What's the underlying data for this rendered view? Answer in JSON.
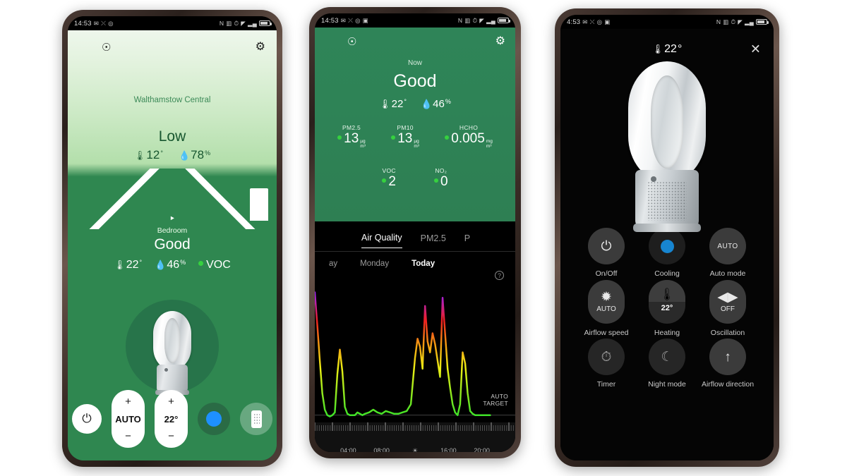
{
  "status_bar": {
    "time": "14:53",
    "time_phone3": "4:53",
    "left_icons": [
      "message-icon",
      "share-icon",
      "alarm-icon",
      "photo-icon"
    ],
    "right_icons": [
      "nfc-N",
      "vibrate-icon",
      "alarm-icon",
      "wifi-icon",
      "signal-icon",
      "battery-icon"
    ]
  },
  "phone1": {
    "topbar": {
      "menu": "menu-icon",
      "bell": "♁",
      "gear": "⚙"
    },
    "outdoor": {
      "location": "Walthamstow Central",
      "level": "Low",
      "temperature": "12",
      "temperature_unit": "°",
      "humidity": "78",
      "humidity_unit": "%"
    },
    "indoor": {
      "wifi": "wifi-icon",
      "room": "Bedroom",
      "quality": "Good",
      "temperature": "22",
      "temperature_unit": "°",
      "humidity": "46",
      "humidity_unit": "%",
      "voc_label": "VOC"
    },
    "controls": {
      "power": "⏻",
      "fan_plus": "+",
      "fan_value": "AUTO",
      "fan_minus": "−",
      "temp_plus": "+",
      "temp_value": "22°",
      "temp_minus": "−",
      "cooling": "cooling-toggle",
      "remote": "remote-icon"
    }
  },
  "phone2": {
    "header": {
      "now_label": "Now",
      "quality": "Good",
      "temperature": "22",
      "temperature_unit": "°",
      "humidity": "46",
      "humidity_unit": "%"
    },
    "pollutants": [
      {
        "label": "PM2.5",
        "value": "13",
        "unit": "µg\nm³"
      },
      {
        "label": "PM10",
        "value": "13",
        "unit": "µg\nm³"
      },
      {
        "label": "HCHO",
        "value": "0.005",
        "unit": "mg\nm³"
      },
      {
        "label": "VOC",
        "value": "2",
        "unit": ""
      },
      {
        "label": "NO₂",
        "value": "0",
        "unit": ""
      }
    ],
    "tabs": [
      {
        "label": "Air Quality",
        "active": true
      },
      {
        "label": "PM2.5",
        "active": false
      },
      {
        "label": "P",
        "active": false
      }
    ],
    "days": [
      {
        "label": "ay",
        "active": false
      },
      {
        "label": "Monday",
        "active": false
      },
      {
        "label": "Today",
        "active": true
      }
    ],
    "help_icon": "?",
    "auto_target_line1": "AUTO",
    "auto_target_line2": "TARGET"
  },
  "phone3": {
    "header": {
      "temperature": "22",
      "temperature_unit": "°",
      "close": "✕"
    },
    "controls": [
      {
        "name": "on-off",
        "glyph": "⏻",
        "sub": "",
        "caption": "On/Off"
      },
      {
        "name": "cooling",
        "glyph": "",
        "sub": "",
        "caption": "Cooling"
      },
      {
        "name": "auto-mode",
        "glyph": "",
        "sub": "AUTO",
        "caption": "Auto mode"
      },
      {
        "name": "airflow-speed",
        "glyph": "✹",
        "sub": "AUTO",
        "caption": "Airflow speed"
      },
      {
        "name": "heating",
        "glyph": "🌡",
        "sub": "22°",
        "caption": "Heating"
      },
      {
        "name": "oscillation",
        "glyph": "◀▶",
        "sub": "OFF",
        "caption": "Oscillation"
      },
      {
        "name": "timer",
        "glyph": "⏱",
        "sub": "",
        "caption": "Timer"
      },
      {
        "name": "night-mode",
        "glyph": "☾",
        "sub": "",
        "caption": "Night mode"
      },
      {
        "name": "airflow-direction",
        "glyph": "↑",
        "sub": "",
        "caption": "Airflow direction"
      }
    ]
  },
  "chart_data": {
    "type": "line",
    "title": "Air Quality",
    "xlabel": "",
    "ylabel": "",
    "xlim": [
      0,
      24
    ],
    "ylim": [
      0,
      100
    ],
    "grid": false,
    "legend": null,
    "annotations": [
      "AUTO TARGET"
    ],
    "tick_labels": [
      "04:00",
      "08:00",
      "☀",
      "16:00",
      "20:00"
    ],
    "tick_positions": [
      4,
      8,
      12,
      16,
      20
    ],
    "color_scale": [
      {
        "stop": 0,
        "color": "#22e02b"
      },
      {
        "stop": 40,
        "color": "#eaee14"
      },
      {
        "stop": 58,
        "color": "#f39a12"
      },
      {
        "stop": 75,
        "color": "#ef2020"
      },
      {
        "stop": 95,
        "color": "#a020f0"
      }
    ],
    "x": [
      0.0,
      0.3,
      0.6,
      0.9,
      1.2,
      1.5,
      1.8,
      2.1,
      2.4,
      2.7,
      3.0,
      3.3,
      3.6,
      3.9,
      4.2,
      4.5,
      4.8,
      5.1,
      5.4,
      5.7,
      6.0,
      6.5,
      7.0,
      7.5,
      8.0,
      8.5,
      9.0,
      9.5,
      10.0,
      10.5,
      11.0,
      11.5,
      12.0,
      12.3,
      12.6,
      12.9,
      13.2,
      13.5,
      13.8,
      14.1,
      14.4,
      14.7,
      15.0,
      15.3,
      15.6,
      15.9,
      16.2,
      16.5,
      16.8,
      17.1,
      17.4,
      17.7,
      18.0,
      18.3,
      18.6,
      18.9,
      19.2,
      19.5,
      19.8,
      20.1,
      20.4,
      20.7,
      21.0
    ],
    "y": [
      96,
      72,
      46,
      22,
      10,
      6,
      5,
      6,
      8,
      36,
      54,
      38,
      12,
      7,
      6,
      6,
      6,
      8,
      7,
      6,
      7,
      8,
      10,
      8,
      7,
      9,
      8,
      7,
      7,
      8,
      9,
      14,
      48,
      62,
      56,
      40,
      86,
      60,
      52,
      66,
      58,
      46,
      34,
      92,
      66,
      40,
      26,
      14,
      8,
      6,
      14,
      52,
      44,
      22,
      9,
      7,
      6,
      6,
      6,
      6,
      6,
      6,
      6
    ]
  }
}
